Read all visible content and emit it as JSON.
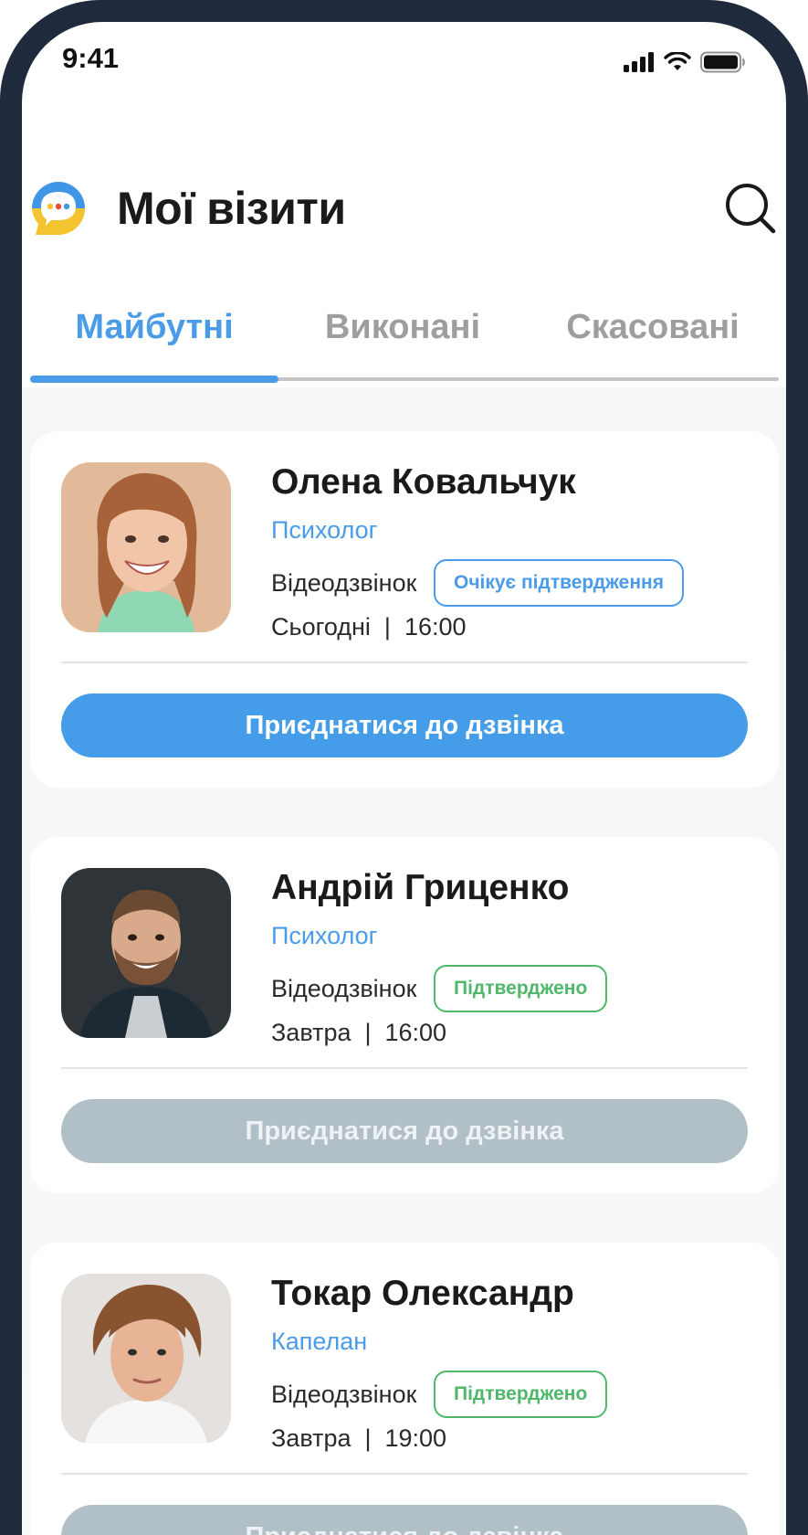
{
  "status_bar": {
    "time": "9:41"
  },
  "header": {
    "title": "Мої візити"
  },
  "tabs": [
    {
      "label": "Майбутні",
      "active": true
    },
    {
      "label": "Виконані",
      "active": false
    },
    {
      "label": "Скасовані",
      "active": false
    }
  ],
  "appointments": [
    {
      "name": "Олена Ковальчук",
      "role": "Психолог",
      "call_type": "Відеодзвінок",
      "status": "Очікує підтвердження",
      "schedule": "Сьогодні  |  16:00",
      "join_label": "Приєднатися до дзвінка",
      "join_enabled": true
    },
    {
      "name": "Андрій Гриценко",
      "role": "Психолог",
      "call_type": "Відеодзвінок",
      "status": "Підтверджено",
      "schedule": "Завтра  |  16:00",
      "join_label": "Приєднатися до дзвінка",
      "join_enabled": false
    },
    {
      "name": "Токар Олександр",
      "role": "Капелан",
      "call_type": "Відеодзвінок",
      "status": "Підтверджено",
      "schedule": "Завтра  |  19:00",
      "join_label": "Приєднатися до дзвінка",
      "join_enabled": false
    }
  ],
  "colors": {
    "accent": "#4a9be8",
    "confirmed": "#4fb86a",
    "disabled_button": "#b1bfc6",
    "frame": "#1f2a3c"
  },
  "icons": [
    "signal-icon",
    "wifi-icon",
    "battery-icon",
    "app-logo-icon",
    "search-icon"
  ]
}
